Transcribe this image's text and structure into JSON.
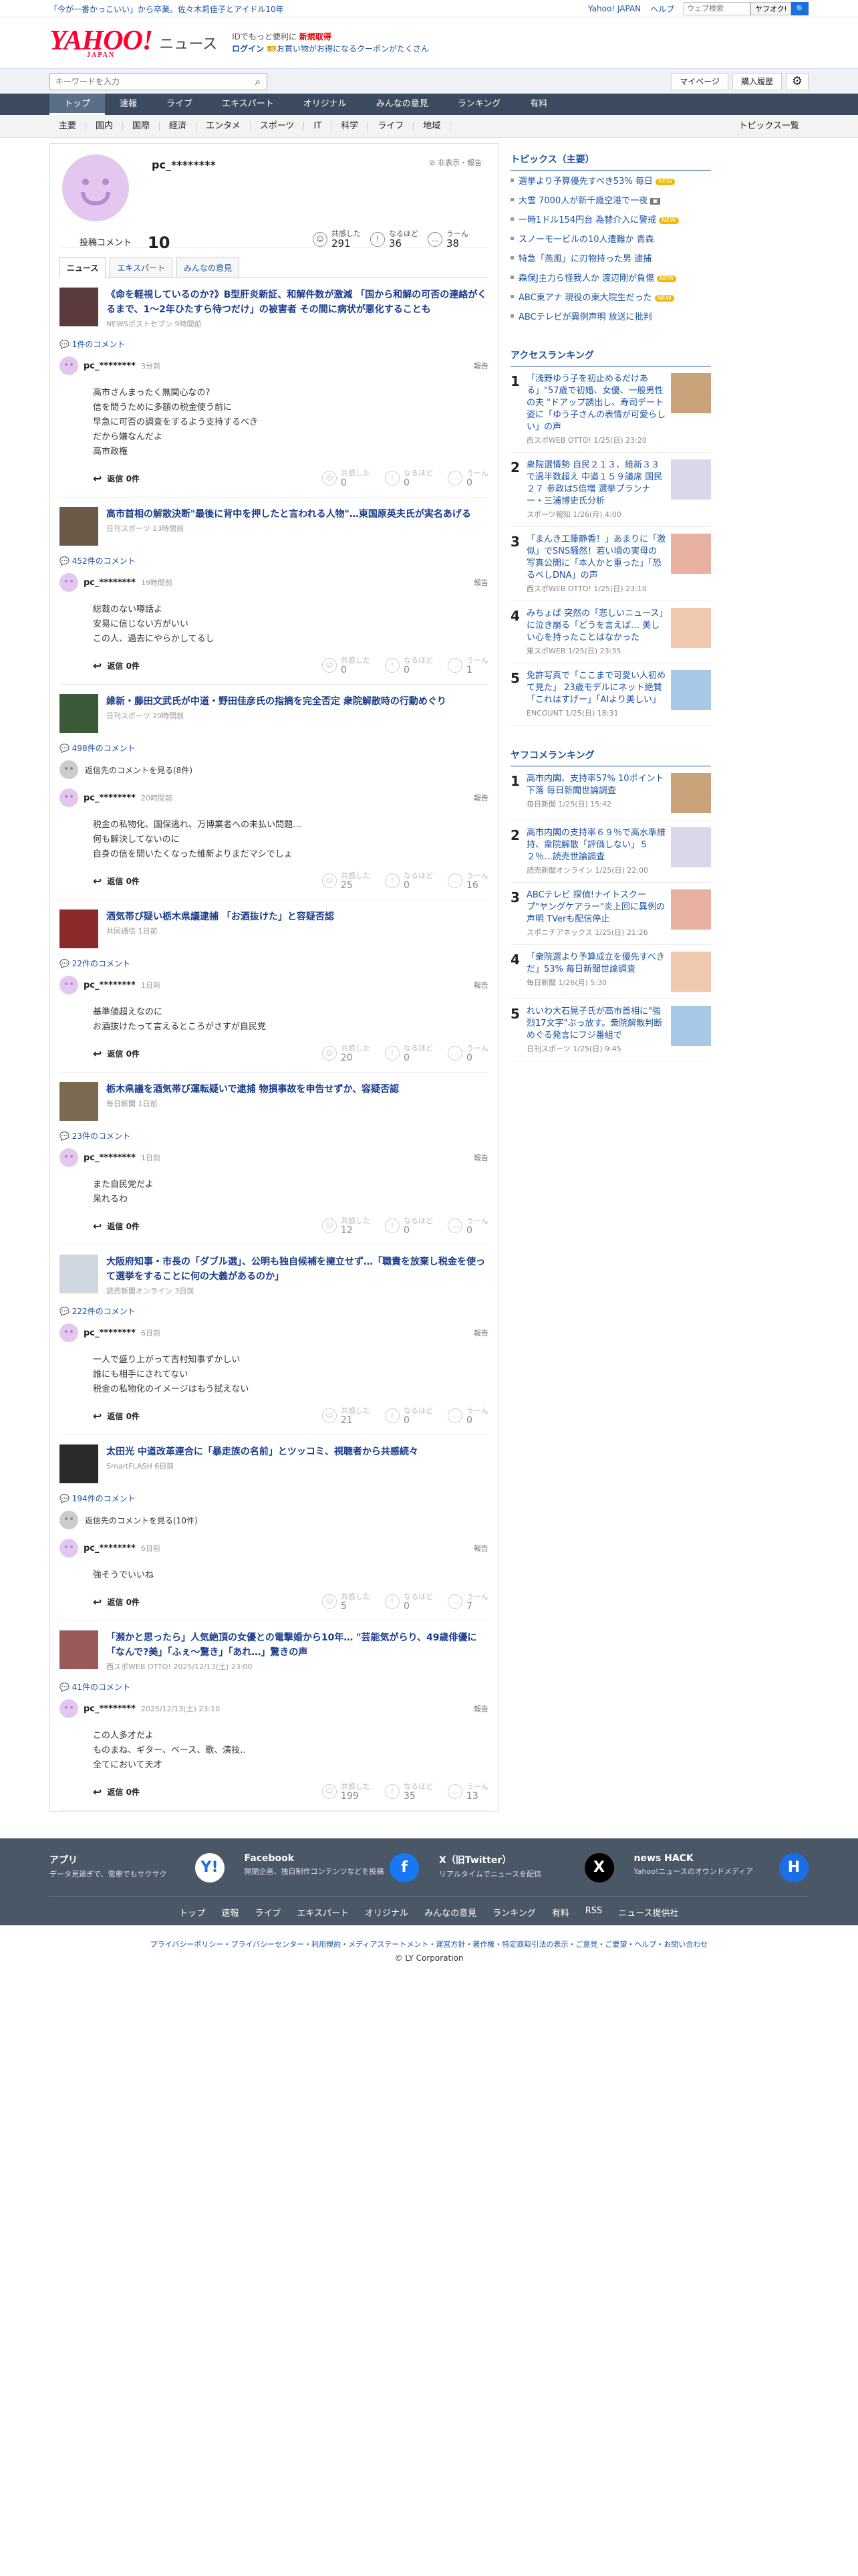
{
  "promo": {
    "left": "「今が一番かっこいい」から卒業。佐々木莉佳子とアイドル10年",
    "links": [
      "Yahoo! JAPAN",
      "ヘルプ"
    ],
    "search_placeholder": "ウェブ検索",
    "search_btn": "ヤフオク!",
    "go": "🔍"
  },
  "header": {
    "logo": "YAHOO!",
    "logo_sub": "JAPAN",
    "title": "ニュース",
    "pr1": "IDでもっと便利に",
    "pr1b": "新規取得",
    "pr2a": "ログイン",
    "pr2b": "お買い物がお得になるクーポンがたくさん"
  },
  "toolbar": {
    "placeholder": "キーワードを入力",
    "mypage": "マイページ",
    "history": "購入履歴"
  },
  "nav": [
    "トップ",
    "速報",
    "ライブ",
    "エキスパート",
    "オリジナル",
    "みんなの意見",
    "ランキング",
    "有料"
  ],
  "subnav": [
    "主要",
    "国内",
    "国際",
    "経済",
    "エンタメ",
    "スポーツ",
    "IT",
    "科学",
    "ライフ",
    "地域"
  ],
  "subnav_more": "トピックス一覧",
  "profile": {
    "name": "pc_********",
    "report": "非表示・報告",
    "post_label": "投稿コメント",
    "post_count": "10",
    "reacts": [
      {
        "label": "共感した",
        "value": "291",
        "icon": "☺"
      },
      {
        "label": "なるほど",
        "value": "36",
        "icon": "!"
      },
      {
        "label": "うーん",
        "value": "38",
        "icon": "…"
      }
    ]
  },
  "tabs": [
    "ニュース",
    "エキスパート",
    "みんなの意見"
  ],
  "articles": [
    {
      "title": "《命を軽視しているのか?》B型肝炎新証、和解件数が激減 「国から和解の可否の連絡がくるまで、1〜2年ひたすら待つだけ」の被害者 その間に病状が悪化することも",
      "src": "NEWSポストセブン 9時間前",
      "count": "1件のコメント",
      "hidden": "",
      "c": {
        "user": "pc_********",
        "time": "3分前",
        "text": "高市さんまったく無関心なの?\n信を問うために多額の税金使う前に\n早急に可否の調査をするよう支持するべき\nだから嫌なんだよ\n高市政権",
        "r": [
          "0",
          "0",
          "0"
        ]
      }
    },
    {
      "title": "高市首相の解散決断\"最後に背中を押したと言われる人物\"…東国原英夫氏が実名あげる",
      "src": "日刊スポーツ 13時間前",
      "count": "452件のコメント",
      "hidden": "",
      "c": {
        "user": "pc_********",
        "time": "19時間前",
        "text": "総裁のない噂話よ\n安易に信じない方がいい\nこの人、過去にやらかしてるし",
        "r": [
          "0",
          "0",
          "1"
        ]
      }
    },
    {
      "title": "維新・藤田文武氏が中道・野田佳彦氏の指摘を完全否定 衆院解散時の行動めぐり",
      "src": "日刊スポーツ 20時間前",
      "count": "498件のコメント",
      "hidden": "返信先のコメントを見る(8件)",
      "c": {
        "user": "pc_********",
        "time": "20時間前",
        "text": "税金の私物化、国保逃れ、万博業者への未払い問題…\n何も解決してないのに\n自身の信を問いたくなった維新よりまだマシでしょ",
        "r": [
          "25",
          "0",
          "16"
        ]
      }
    },
    {
      "title": "酒気帯び疑い栃木県議逮捕 「お酒抜けた」と容疑否認",
      "src": "共同通信 1日前",
      "count": "22件のコメント",
      "hidden": "",
      "c": {
        "user": "pc_********",
        "time": "1日前",
        "text": "基準値超えなのに\nお酒抜けたって言えるところがさすが自民党",
        "r": [
          "20",
          "0",
          "0"
        ]
      }
    },
    {
      "title": "栃木県議を酒気帯び運転疑いで逮捕 物損事故を申告せずか、容疑否認",
      "src": "毎日新聞 1日前",
      "count": "23件のコメント",
      "hidden": "",
      "c": {
        "user": "pc_********",
        "time": "1日前",
        "text": "また自民党だよ\n呆れるわ",
        "r": [
          "12",
          "0",
          "0"
        ]
      }
    },
    {
      "title": "大阪府知事・市長の「ダブル選」、公明も独自候補を擁立せず…「職責を放棄し税金を使って選挙をすることに何の大義があるのか」",
      "src": "読売新聞オンライン 3日前",
      "count": "222件のコメント",
      "hidden": "",
      "c": {
        "user": "pc_********",
        "time": "6日前",
        "text": "一人で盛り上がって吉村知事ずかしい\n誰にも相手にされてない\n税金の私物化のイメージはもう拭えない",
        "r": [
          "21",
          "0",
          "0"
        ]
      }
    },
    {
      "title": "太田光 中道改革連合に「暴走族の名前」とツッコミ、視聴者から共感続々",
      "src": "SmartFLASH 6日前",
      "count": "194件のコメント",
      "hidden": "返信先のコメントを見る(10件)",
      "c": {
        "user": "pc_********",
        "time": "6日前",
        "text": "強そうでいいね",
        "r": [
          "5",
          "0",
          "7"
        ]
      }
    },
    {
      "title": "「瀕かと思ったら」人気絶頂の女優との電撃婚から10年… \"芸能気がらり、49歳俳優に「なんで?美」「ふぇ〜驚き」「あれ…」驚きの声",
      "src": "西スポWEB OTTO! 2025/12/13(土) 23:00",
      "count": "41件のコメント",
      "hidden": "",
      "c": {
        "user": "pc_********",
        "time": "2025/12/13(土) 23:10",
        "text": "この人多才だよ\nものまね、ギター、ベース、歌、演技..\n全てにおいて天才",
        "r": [
          "199",
          "35",
          "13"
        ]
      }
    }
  ],
  "reply_label": "返信 0件",
  "react_labels": [
    "共感した",
    "なるほど",
    "うーん"
  ],
  "report": "報告",
  "side": {
    "topics_title": "トピックス（主要）",
    "topics": [
      {
        "t": "選挙より予算優先すべき53% 毎日",
        "b": "new"
      },
      {
        "t": "大雪 7000人が新千歳空港で一夜",
        "b": "photo"
      },
      {
        "t": "一時1ドル154円台 為替介入に警戒",
        "b": "new"
      },
      {
        "t": "スノーモービルの10人遭難か 青森",
        "b": ""
      },
      {
        "t": "特急「燕風」に刃物持った男 逮捕",
        "b": ""
      },
      {
        "t": "森保J主力ら怪我人か 渡辺剛が負傷",
        "b": "new"
      },
      {
        "t": "ABC東アナ 現役の東大院生だった",
        "b": "new"
      },
      {
        "t": "ABCテレビが異例声明 放送に批判",
        "b": ""
      }
    ],
    "access_title": "アクセスランキング",
    "access": [
      {
        "t": "「浅野ゆう子を初止めるだけある」\"57歳で初婚、女優、一般男性の夫 \"ドアップ誘出し、寿司デート姿に「ゆう子さんの表情が可愛らしい」の声",
        "s": "西スポWEB OTTO! 1/25(日) 23:20"
      },
      {
        "t": "衆院選情勢 自民２１３、維新３３で過半数超え 中道１５９議席 国民２７ 参政は5倍増 選挙プランナー・三浦博史氏分析",
        "s": "スポーツ報知 1/26(月) 4:00"
      },
      {
        "t": "「まんき工藤静香！」あまりに「激似」でSNS騒然！若い頃の実母の写真公開に「本人かと重った」「恐るべしDNA」の声",
        "s": "西スポWEB OTTO! 1/25(日) 23:10"
      },
      {
        "t": "みちょぱ 突然の「悲しいニュース」に泣き崩る「どうを言えば… 美しい心を持ったことはなかった",
        "s": "東スポWEB 1/25(日) 23:35"
      },
      {
        "t": "免許写真で「ここまで可愛い人初めて見た」 23歳モデルにネット絶賛「これはすげー」「AIより美しい」",
        "s": "ENCOUNT 1/25(日) 18:31"
      }
    ],
    "yahoo_title": "ヤフコメランキング",
    "yahoo": [
      {
        "t": "高市内閣、支持率57% 10ポイント下落 毎日新聞世論調査",
        "s": "毎日新聞 1/25(日) 15:42"
      },
      {
        "t": "高市内閣の支持率６９％で高水準維持、衆院解散「評価しない」５２％…読売世論調査",
        "s": "読売新聞オンライン 1/25(日) 22:00"
      },
      {
        "t": "ABCテレビ 探偵!ナイトスクープ\"ヤングケアラー\"炎上回に異例の声明 TVerも配信停止",
        "s": "スポニチアネックス 1/25(日) 21:26"
      },
      {
        "t": "「衆院選より予算成立を優先すべきだ」53% 毎日新聞世論調査",
        "s": "毎日新聞 1/26(月) 5:30"
      },
      {
        "t": "れいわ大石晃子氏が高市首相に\"強烈17文字\"ぶっ放す。衆院解散判断めぐる発言にフジ番組で",
        "s": "日刊スポーツ 1/25(日) 9:45"
      }
    ]
  },
  "footer": {
    "cards": [
      {
        "title": "アプリ",
        "desc": "データ見過ぎで、電車でもサクサク",
        "icon": "Y!"
      },
      {
        "title": "Facebook",
        "desc": "開閉企画、独自制作コンテンツなどを投稿",
        "icon": "f"
      },
      {
        "title": "X（旧Twitter）",
        "desc": "リアルタイムでニュースを配信",
        "icon": "X"
      },
      {
        "title": "news HACK",
        "desc": "Yahoo!ニュースのオウンドメディア",
        "icon": "H"
      }
    ],
    "links": [
      "トップ",
      "速報",
      "ライブ",
      "エキスパート",
      "オリジナル",
      "みんなの意見",
      "ランキング",
      "有料",
      "RSS",
      "ニュース提供社"
    ],
    "legal": "プライバシーポリシー・プライバシーセンター・利用規約・メディアステートメント・運営方針・著作権・特定商取引法の表示・ご意見・ご要望・ヘルプ・お問い合わせ",
    "copy": "© LY Corporation"
  },
  "colors": {
    "accent": "#1a53a3",
    "nav": "#3b4a5e",
    "brand": "#ff0033"
  }
}
